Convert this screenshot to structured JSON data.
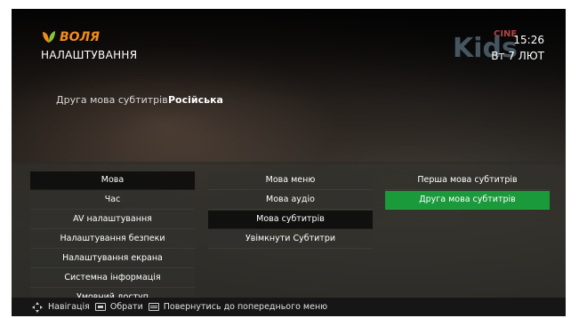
{
  "brand": {
    "name": "ВОЛЯ"
  },
  "header": {
    "title": "НАЛАШТУВАННЯ",
    "time": "15:26",
    "date": "Вт 7 ЛЮТ"
  },
  "channel": {
    "logo_text": "Kids",
    "logo_badge": "CINE"
  },
  "info": {
    "label": "Друга мова субтитрів",
    "value": "Російська"
  },
  "menu": {
    "main": [
      {
        "label": "Мова"
      },
      {
        "label": "Час"
      },
      {
        "label": "AV налаштування"
      },
      {
        "label": "Налаштування безпеки"
      },
      {
        "label": "Налаштування екрана"
      },
      {
        "label": "Системна інформація"
      },
      {
        "label": "Умовний доступ"
      }
    ],
    "language": [
      {
        "label": "Мова меню"
      },
      {
        "label": "Мова аудіо"
      },
      {
        "label": "Мова субтитрів"
      },
      {
        "label": "Увімкнути Субтитри"
      }
    ],
    "subtitles": [
      {
        "label": "Перша мова субтитрів"
      },
      {
        "label": "Друга мова субтитрів"
      }
    ]
  },
  "footer": {
    "navigate": "Навігація",
    "select": "Обрати",
    "back": "Повернутись до попереднього меню"
  },
  "colors": {
    "brand": "#f28c1c",
    "focus": "#1a9a3a"
  }
}
